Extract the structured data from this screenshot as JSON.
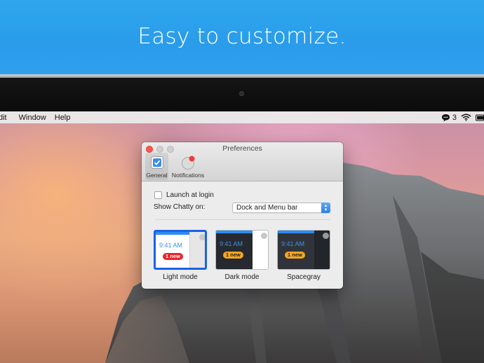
{
  "banner": {
    "title": "Easy to customize."
  },
  "menubar": {
    "items": [
      "dit",
      "Window",
      "Help"
    ],
    "chat_count": "3"
  },
  "window": {
    "title": "Preferences",
    "tabs": [
      {
        "label": "General",
        "icon": "checkbox-icon",
        "selected": true
      },
      {
        "label": "Notifications",
        "icon": "notification-bubble-icon",
        "selected": false
      }
    ],
    "launch_at_login": {
      "label": "Launch at login",
      "checked": false
    },
    "show_on": {
      "label": "Show Chatty on:",
      "value": "Dock and Menu bar"
    },
    "modes": [
      {
        "caption": "Light mode",
        "time": "9:41 AM",
        "badge": "1 new",
        "selected": true
      },
      {
        "caption": "Dark mode",
        "time": "9:41 AM",
        "badge": "1 new",
        "selected": false
      },
      {
        "caption": "Spacegray",
        "time": "9:41 AM",
        "badge": "1 new",
        "selected": false
      }
    ]
  },
  "colors": {
    "banner_blue": "#2a9cea",
    "accent_blue": "#1a62e8",
    "close_red": "#fc5753",
    "badge_red": "#e8252e",
    "badge_orange": "#f5a623",
    "dark_panel": "#262a30",
    "spacegray_panel": "#30343a"
  }
}
